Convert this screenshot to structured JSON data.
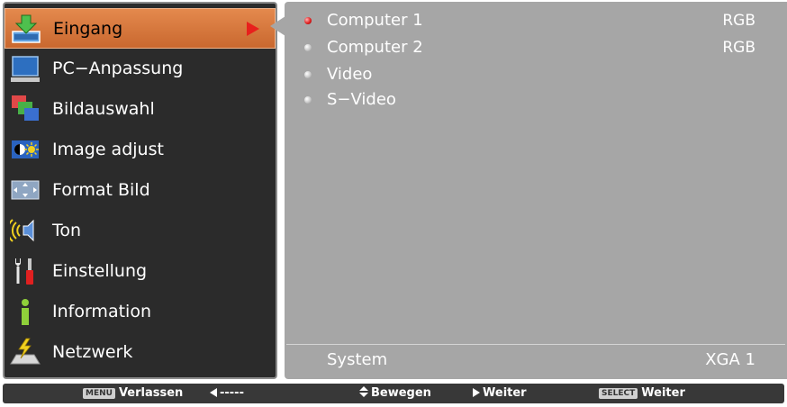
{
  "menu": {
    "items": [
      {
        "label": "Eingang",
        "icon": "input-icon",
        "selected": true
      },
      {
        "label": "PC−Anpassung",
        "icon": "monitor-icon"
      },
      {
        "label": "Bildauswahl",
        "icon": "image-select-icon"
      },
      {
        "label": "Image adjust",
        "icon": "image-adjust-icon"
      },
      {
        "label": "Format Bild",
        "icon": "screen-format-icon"
      },
      {
        "label": "Ton",
        "icon": "speaker-icon"
      },
      {
        "label": "Einstellung",
        "icon": "tools-icon"
      },
      {
        "label": "Information",
        "icon": "info-icon"
      },
      {
        "label": "Netzwerk",
        "icon": "network-icon"
      }
    ]
  },
  "inputs": [
    {
      "label": "Computer 1",
      "value": "RGB",
      "active": true
    },
    {
      "label": "Computer 2",
      "value": "RGB"
    },
    {
      "label": "Video",
      "value": ""
    },
    {
      "label": "S−Video",
      "value": ""
    }
  ],
  "system": {
    "label": "System",
    "value": "XGA 1"
  },
  "footer": {
    "menu_key": "MENU",
    "exit_label": "Verlassen",
    "back_dashes": "-----",
    "move_label": "Bewegen",
    "next_label": "Weiter",
    "select_key": "SELECT",
    "select_label": "Weiter"
  },
  "colors": {
    "selected_item": "#d2743a",
    "left_panel_bg": "#2b2b2b",
    "right_panel_bg": "#a6a6a6",
    "active_bullet": "#e02020",
    "footer_bg": "#383838"
  }
}
